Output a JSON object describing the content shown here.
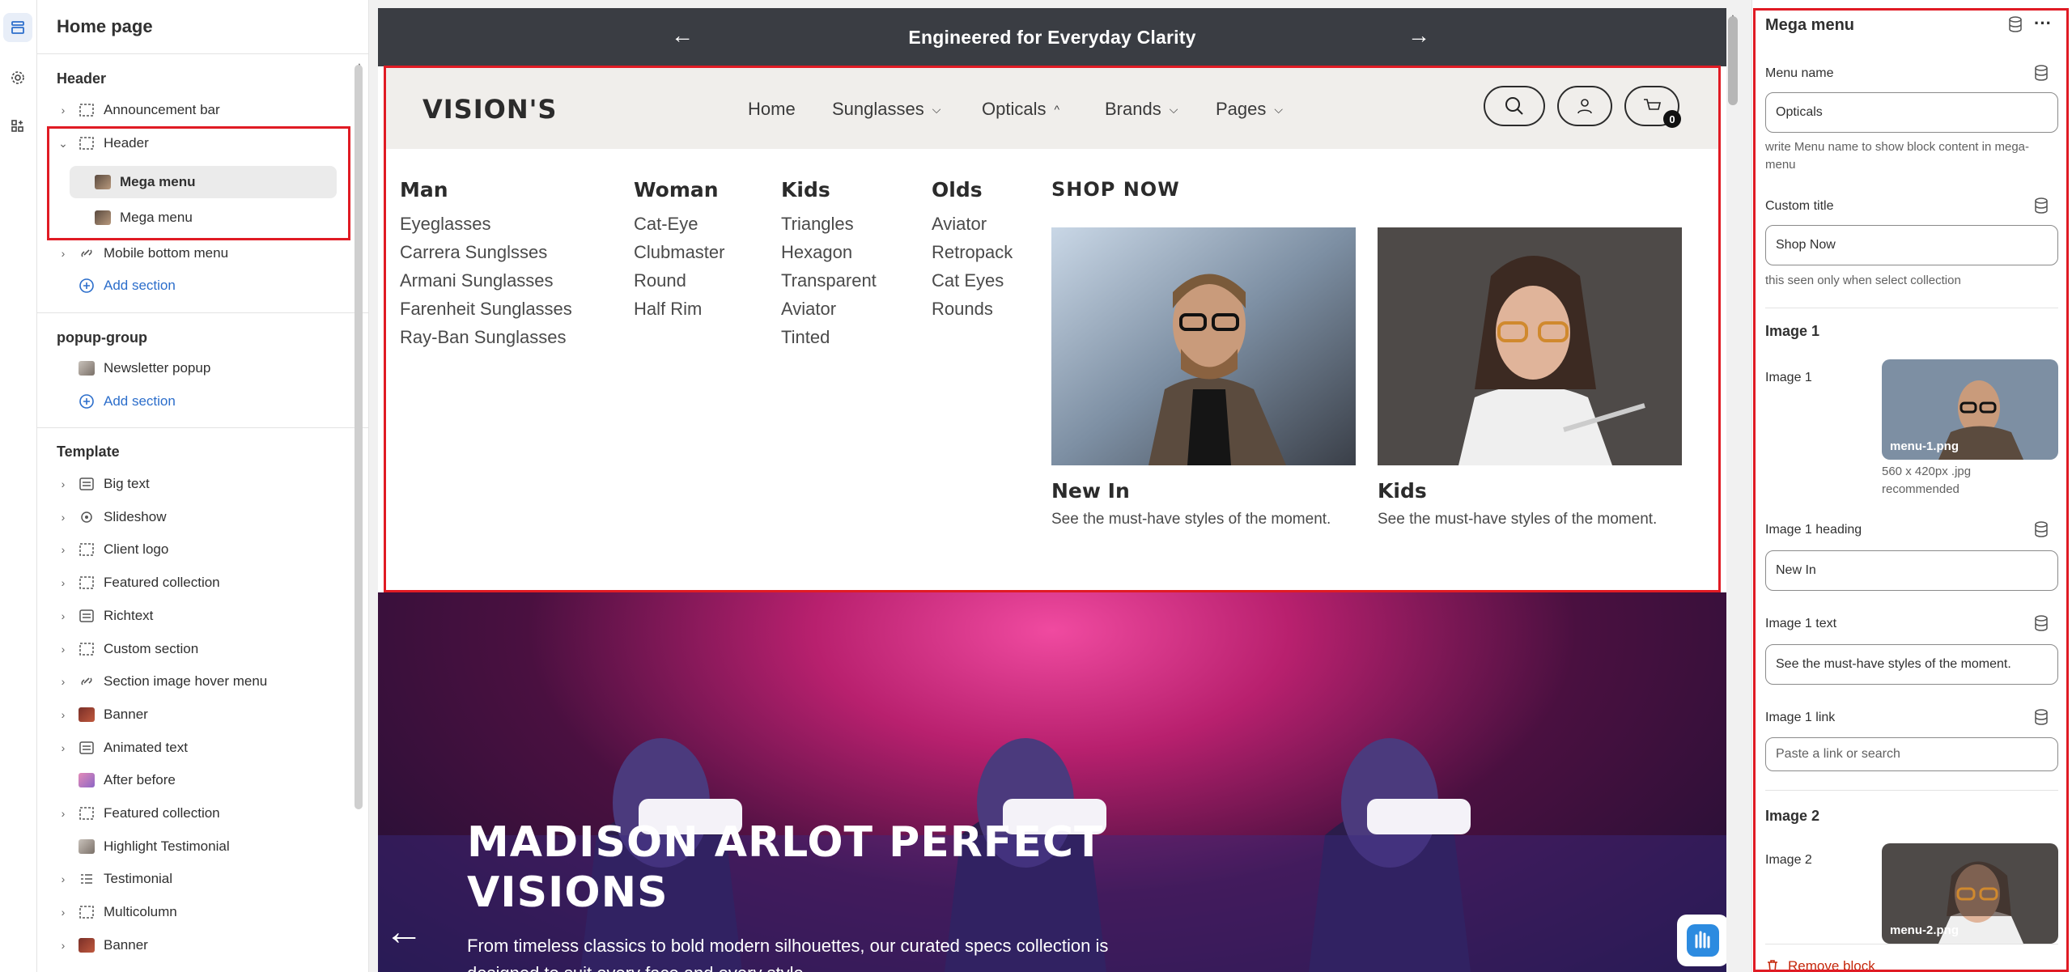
{
  "sidebar": {
    "title": "Home page",
    "header_group": "Header",
    "header_items": [
      {
        "label": "Announcement bar"
      },
      {
        "label": "Header"
      },
      {
        "label": "Mega menu"
      },
      {
        "label": "Mega menu"
      },
      {
        "label": "Mobile bottom menu"
      }
    ],
    "add_section": "Add section",
    "popup_group": "popup-group",
    "popup_items": [
      {
        "label": "Newsletter popup"
      }
    ],
    "template_group": "Template",
    "template_items": [
      {
        "label": "Big text"
      },
      {
        "label": "Slideshow"
      },
      {
        "label": "Client logo"
      },
      {
        "label": "Featured collection"
      },
      {
        "label": "Richtext"
      },
      {
        "label": "Custom section"
      },
      {
        "label": "Section image hover menu"
      },
      {
        "label": "Banner"
      },
      {
        "label": "Animated text"
      },
      {
        "label": "After before"
      },
      {
        "label": "Featured collection"
      },
      {
        "label": "Highlight Testimonial"
      },
      {
        "label": "Testimonial"
      },
      {
        "label": "Multicolumn"
      },
      {
        "label": "Banner"
      }
    ]
  },
  "preview": {
    "announcement": "Engineered for Everyday Clarity",
    "logo": "VISION'S",
    "nav": [
      "Home",
      "Sunglasses",
      "Opticals",
      "Brands",
      "Pages"
    ],
    "cart_count": "0",
    "mega": {
      "columns": [
        {
          "title": "Man",
          "items": [
            "Eyeglasses",
            "Carrera Sunglsses",
            "Armani Sunglasses",
            "Farenheit Sunglasses",
            "Ray-Ban Sunglasses"
          ]
        },
        {
          "title": "Woman",
          "items": [
            "Cat-Eye",
            "Clubmaster",
            "Round",
            "Half Rim"
          ]
        },
        {
          "title": "Kids",
          "items": [
            "Triangles",
            "Hexagon",
            "Transparent",
            "Aviator",
            "Tinted"
          ]
        },
        {
          "title": "Olds",
          "items": [
            "Aviator",
            "Retropack",
            "Cat Eyes",
            "Rounds"
          ]
        }
      ],
      "shop_title": "SHOP NOW",
      "cards": [
        {
          "heading": "New In",
          "text": "See the must-have styles of the moment."
        },
        {
          "heading": "Kids",
          "text": "See the must-have styles of the moment."
        }
      ]
    },
    "hero": {
      "title": "MADISON ARLOT PERFECT VISIONS",
      "subtitle": "From timeless classics to bold modern silhouettes, our curated specs collection is designed to suit every face and every style."
    }
  },
  "panel": {
    "title": "Mega menu",
    "menu_name_label": "Menu name",
    "menu_name_value": "Opticals",
    "menu_name_help": "write Menu name to show block content in mega-menu",
    "custom_title_label": "Custom title",
    "custom_title_value": "Shop Now",
    "custom_title_help": "this seen only when select collection",
    "image1_section": "Image 1",
    "image1_label": "Image 1",
    "image1_file": "menu-1.png",
    "image1_help": "560 x 420px .jpg recommended",
    "image1_heading_label": "Image 1 heading",
    "image1_heading_value": "New In",
    "image1_text_label": "Image 1 text",
    "image1_text_value": "See the must-have styles of the moment.",
    "image1_link_label": "Image 1 link",
    "image1_link_placeholder": "Paste a link or search",
    "image2_section": "Image 2",
    "image2_label": "Image 2",
    "image2_file": "menu-2.png",
    "remove_block": "Remove block"
  },
  "colors": {
    "highlight": "#e01b24",
    "link": "#2c6ecb",
    "announcement_bg": "#3a3d43"
  }
}
